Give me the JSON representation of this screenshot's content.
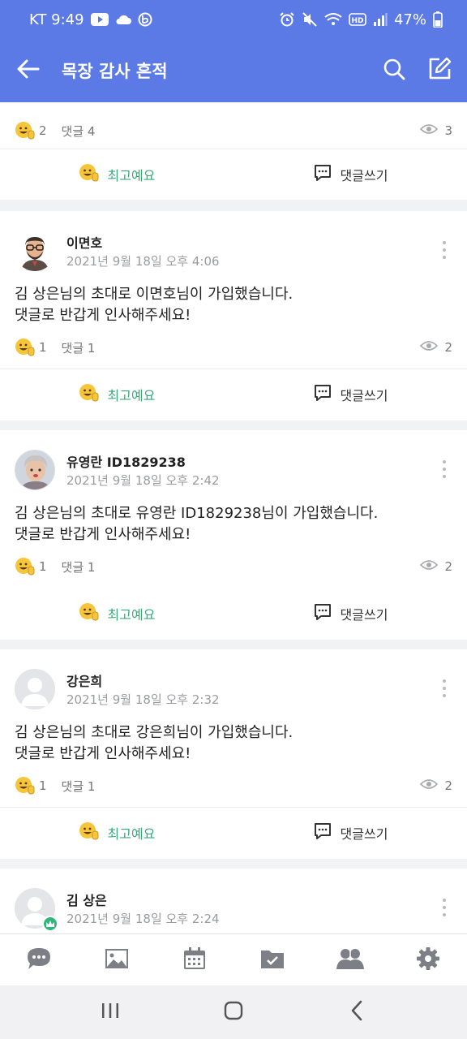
{
  "status_bar": {
    "carrier_time": "KT 9:49",
    "battery": "47%",
    "icons": [
      "youtube-icon",
      "cloud-icon",
      "b-app-icon",
      "alarm-icon",
      "mute-icon",
      "wifi-icon",
      "hd-icon",
      "signal-icon",
      "battery-icon"
    ]
  },
  "app_bar": {
    "title": "목장 감사 흔적",
    "back_icon": "arrow-left-icon",
    "search_icon": "search-icon",
    "write_icon": "edit-icon"
  },
  "colors": {
    "accent": "#5b7ae6",
    "like_green": "#3aa97a",
    "muted_text": "#9a9ca0",
    "separator": "#f1f2f4"
  },
  "partial_post": {
    "like_count": "2",
    "comment_label": "댓글 4",
    "views": "3",
    "like_label": "최고예요",
    "comment_action": "댓글쓰기"
  },
  "posts": [
    {
      "author": "이면호",
      "time": "2021년 9월 18일 오후 4:06",
      "line1": "김 상은님의 초대로 이면호님이 가입했습니다.",
      "line2": "댓글로 반갑게 인사해주세요!",
      "like_count": "1",
      "comment_label": "댓글 1",
      "views": "2",
      "like_label": "최고예요",
      "comment_action": "댓글쓰기"
    },
    {
      "author": "유영란 ID1829238",
      "time": "2021년 9월 18일 오후 2:42",
      "line1": "김 상은님의 초대로 유영란 ID1829238님이 가입했습니다.",
      "line2": "댓글로 반갑게 인사해주세요!",
      "like_count": "1",
      "comment_label": "댓글 1",
      "views": "2",
      "like_label": "최고예요",
      "comment_action": "댓글쓰기"
    },
    {
      "author": "강은희",
      "time": "2021년 9월 18일 오후 2:32",
      "line1": "김 상은님의 초대로 강은희님이 가입했습니다.",
      "line2": "댓글로 반갑게 인사해주세요!",
      "like_count": "1",
      "comment_label": "댓글 1",
      "views": "2",
      "like_label": "최고예요",
      "comment_action": "댓글쓰기"
    },
    {
      "author": "김 상은",
      "time": "2021년 9월 18일 오후 2:24"
    }
  ],
  "bottom_nav": [
    "chat-icon",
    "photo-icon",
    "calendar-icon",
    "folder-check-icon",
    "members-icon",
    "settings-icon"
  ],
  "system_nav": [
    "recent-apps-icon",
    "home-icon",
    "back-icon"
  ]
}
